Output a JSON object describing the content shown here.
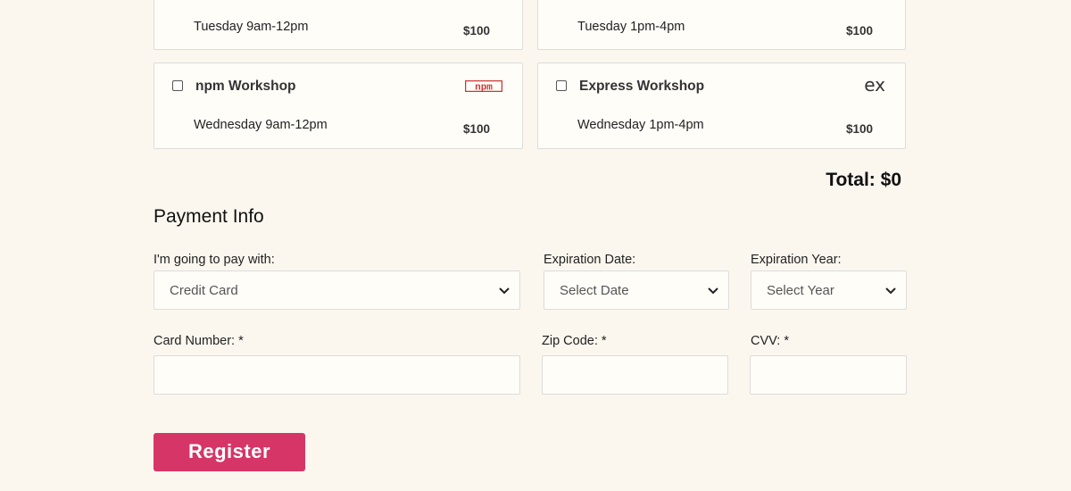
{
  "workshops": [
    {
      "time": "Tuesday 9am-12pm",
      "price": "$100"
    },
    {
      "time": "Tuesday 1pm-4pm",
      "price": "$100"
    },
    {
      "title": "npm Workshop",
      "time": "Wednesday 9am-12pm",
      "price": "$100",
      "logo": "npm",
      "checked": false
    },
    {
      "title": "Express Workshop",
      "time": "Wednesday 1pm-4pm",
      "price": "$100",
      "logo": "ex",
      "checked": false
    }
  ],
  "total": "Total: $0",
  "payment": {
    "heading": "Payment Info",
    "method_label": "I'm going to pay with:",
    "method_value": "Credit Card",
    "exp_date_label": "Expiration Date:",
    "exp_date_value": "Select Date",
    "exp_year_label": "Expiration Year:",
    "exp_year_value": "Select Year",
    "card_label": "Card Number: *",
    "zip_label": "Zip Code: *",
    "cvv_label": "CVV: *"
  },
  "register_label": "Register",
  "colors": {
    "accent": "#d63567",
    "npm_red": "#cb3837",
    "background": "#fbf7ef"
  }
}
